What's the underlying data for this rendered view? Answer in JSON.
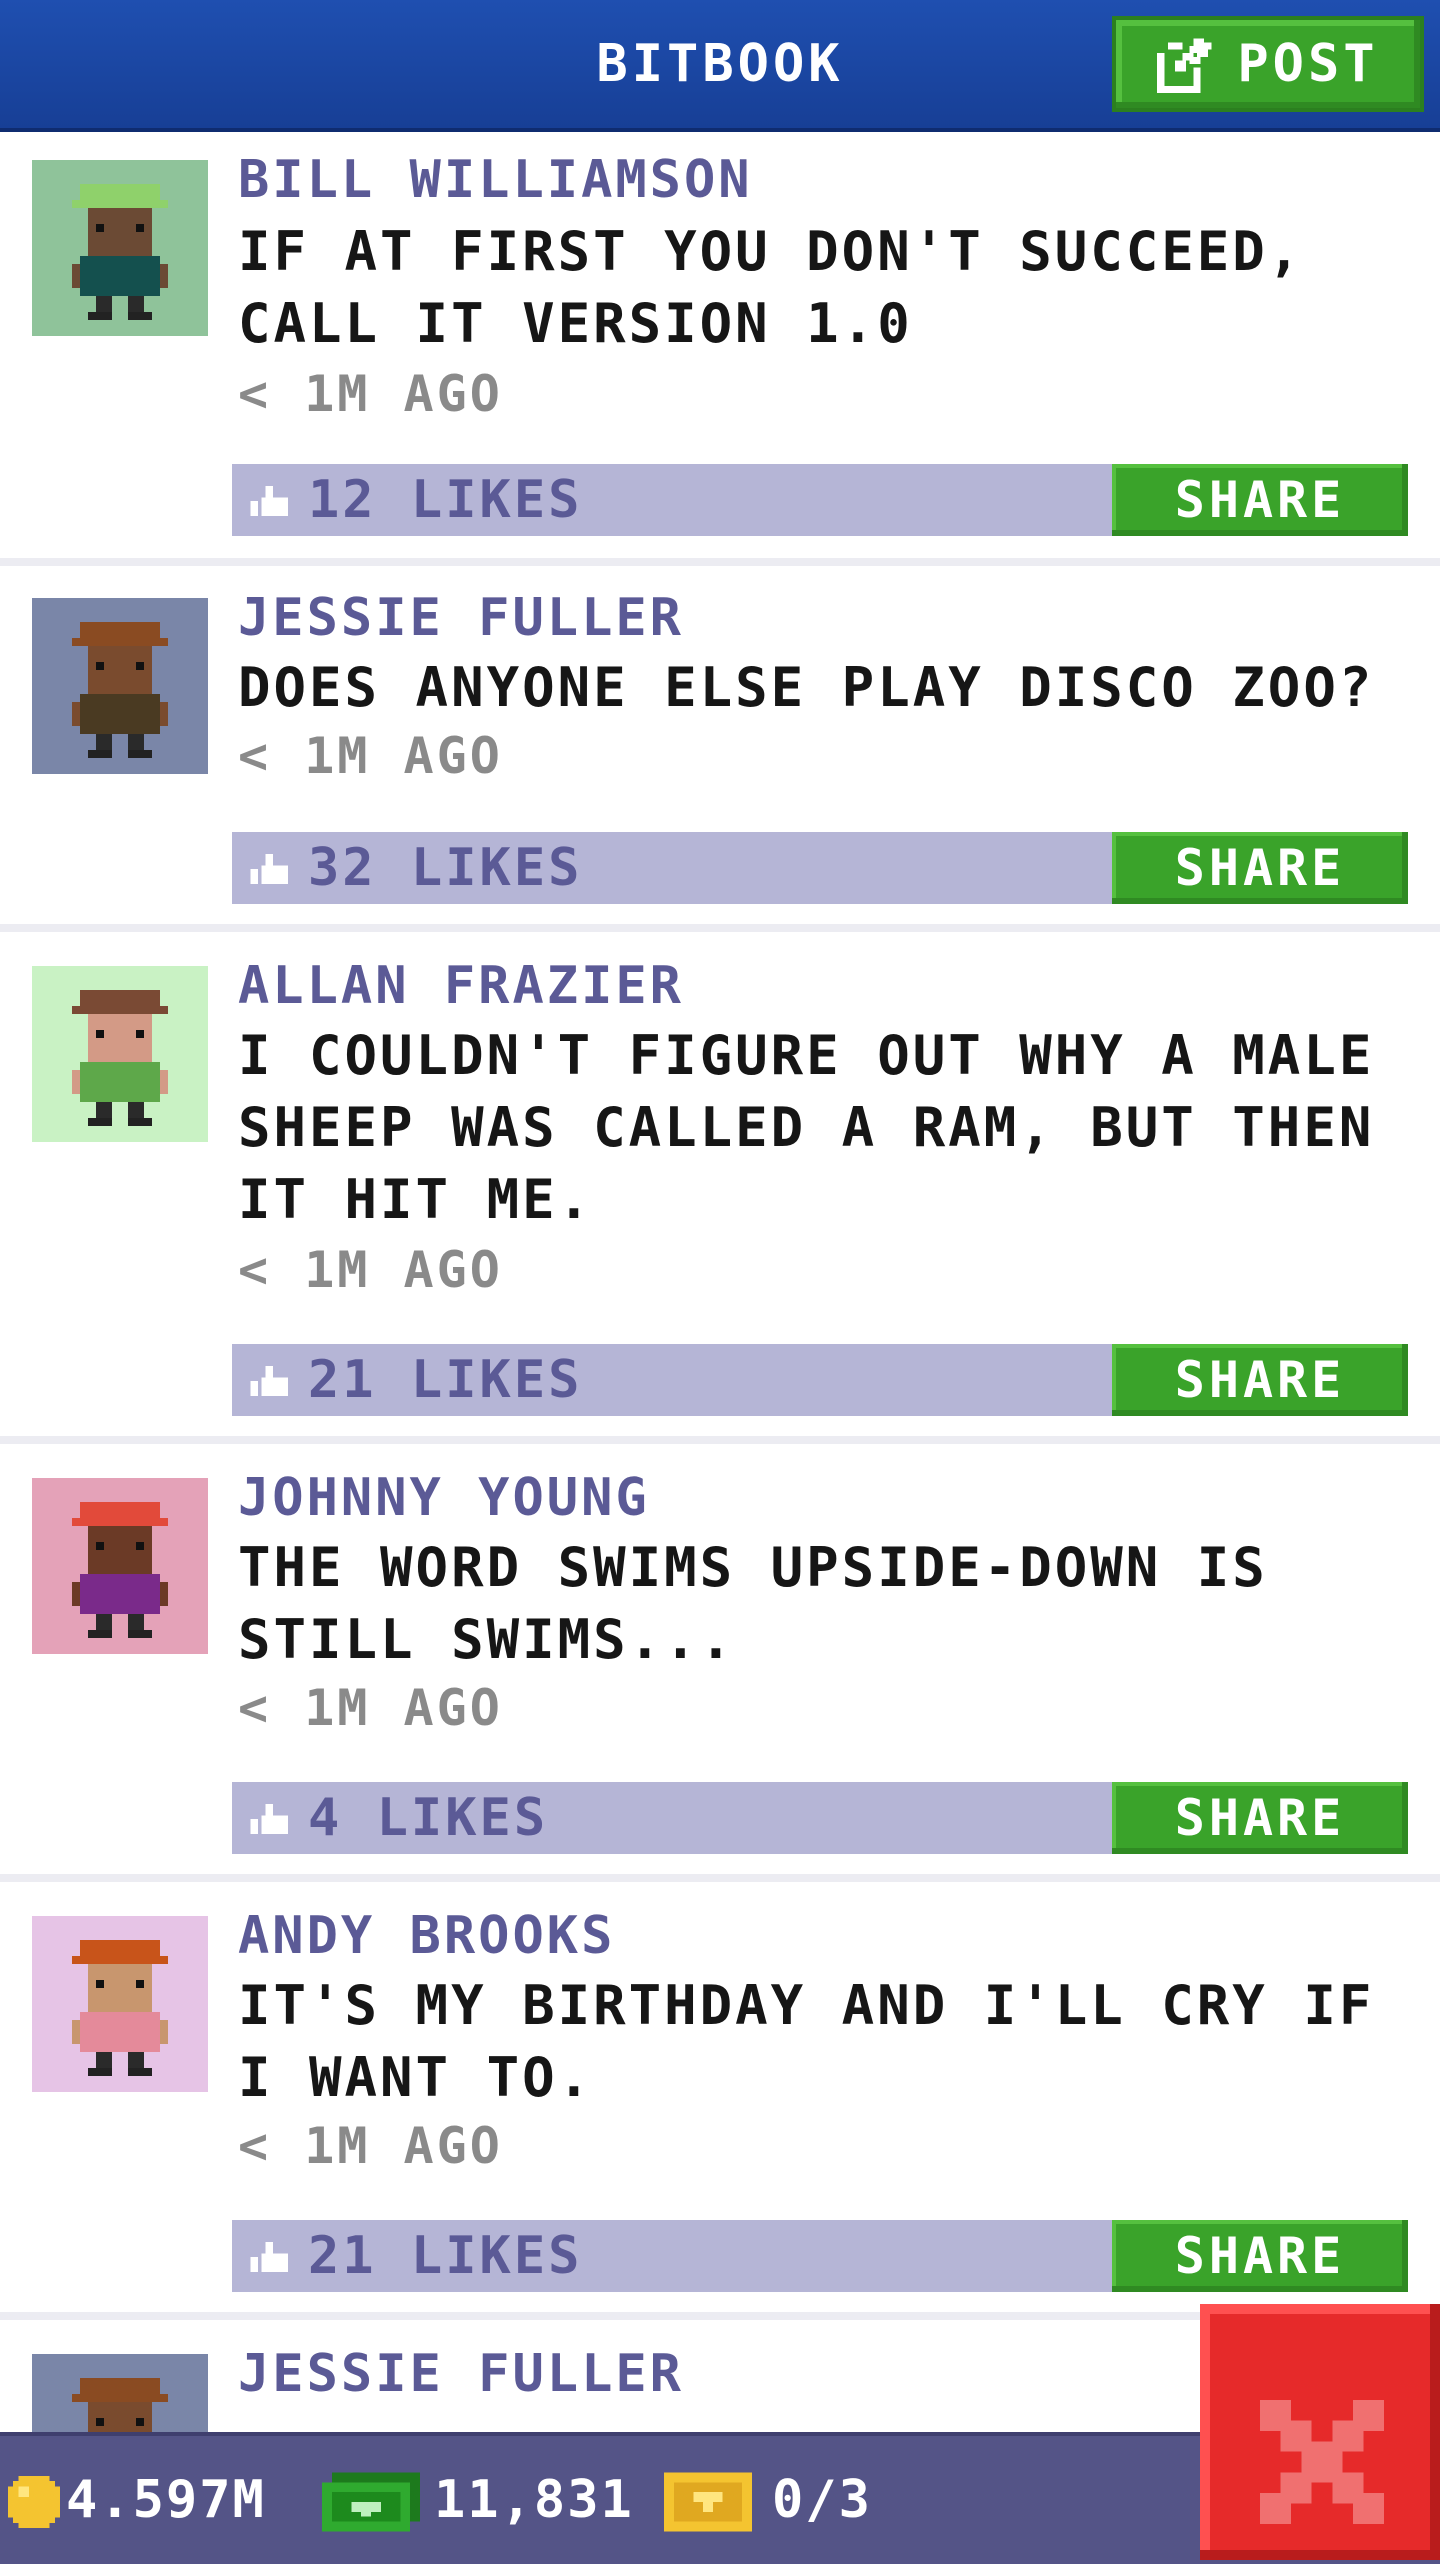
{
  "header": {
    "title": "BITBOOK",
    "post_label": "POST"
  },
  "posts": [
    {
      "name": "BILL WILLIAMSON",
      "text": "IF AT FIRST YOU DON'T SUCCEED, CALL IT VERSION 1.0",
      "time": "< 1M AGO",
      "likes": "12 LIKES",
      "share": "SHARE",
      "avatar_bg": "#8fc39a",
      "avatar_hat": "#8fd16b",
      "avatar_skin": "#6b4a34",
      "avatar_shirt": "#14504e"
    },
    {
      "name": "JESSIE FULLER",
      "text": "DOES ANYONE ELSE PLAY DISCO ZOO?",
      "time": "< 1M AGO",
      "likes": "32 LIKES",
      "share": "SHARE",
      "avatar_bg": "#7a86a8",
      "avatar_hat": "#8a4b22",
      "avatar_skin": "#7a4b2e",
      "avatar_shirt": "#4a3a22"
    },
    {
      "name": "ALLAN FRAZIER",
      "text": "I COULDN'T FIGURE OUT WHY A MALE SHEEP WAS CALLED A RAM, BUT THEN IT HIT ME.",
      "time": "< 1M AGO",
      "likes": "21 LIKES",
      "share": "SHARE",
      "avatar_bg": "#c9f2c4",
      "avatar_hat": "#7a4a34",
      "avatar_skin": "#d39a86",
      "avatar_shirt": "#5ea84a"
    },
    {
      "name": "JOHNNY YOUNG",
      "text": "THE WORD SWIMS UPSIDE-DOWN IS STILL SWIMS...",
      "time": "< 1M AGO",
      "likes": "4 LIKES",
      "share": "SHARE",
      "avatar_bg": "#e4a2b8",
      "avatar_hat": "#e24a3a",
      "avatar_skin": "#6b3a26",
      "avatar_shirt": "#7a2a8a"
    },
    {
      "name": "ANDY BROOKS",
      "text": "IT'S MY BIRTHDAY AND I'LL CRY IF I WANT TO.",
      "time": "< 1M AGO",
      "likes": "21 LIKES",
      "share": "SHARE",
      "avatar_bg": "#e6c4e6",
      "avatar_hat": "#c8541a",
      "avatar_skin": "#c8966e",
      "avatar_shirt": "#e48a9a"
    },
    {
      "name": "JESSIE FULLER",
      "avatar_bg": "#7a86a8",
      "avatar_hat": "#8a4b22",
      "avatar_skin": "#7a4b2e",
      "avatar_shirt": "#4a3a22"
    }
  ],
  "bottom_bar": {
    "coins": "4.597M",
    "bux": "11,831",
    "tickets": "0/3"
  },
  "colors": {
    "header": "#1f4fb0",
    "green": "#3aa32a",
    "like_bar": "#b5b5d6",
    "name": "#5b5a96",
    "close": "#e62a2a"
  },
  "icons": {
    "post": "edit-icon",
    "like": "thumbs-up-icon",
    "coin": "coin-icon",
    "bux": "cash-icon",
    "ticket": "ticket-icon",
    "close": "close-icon"
  }
}
